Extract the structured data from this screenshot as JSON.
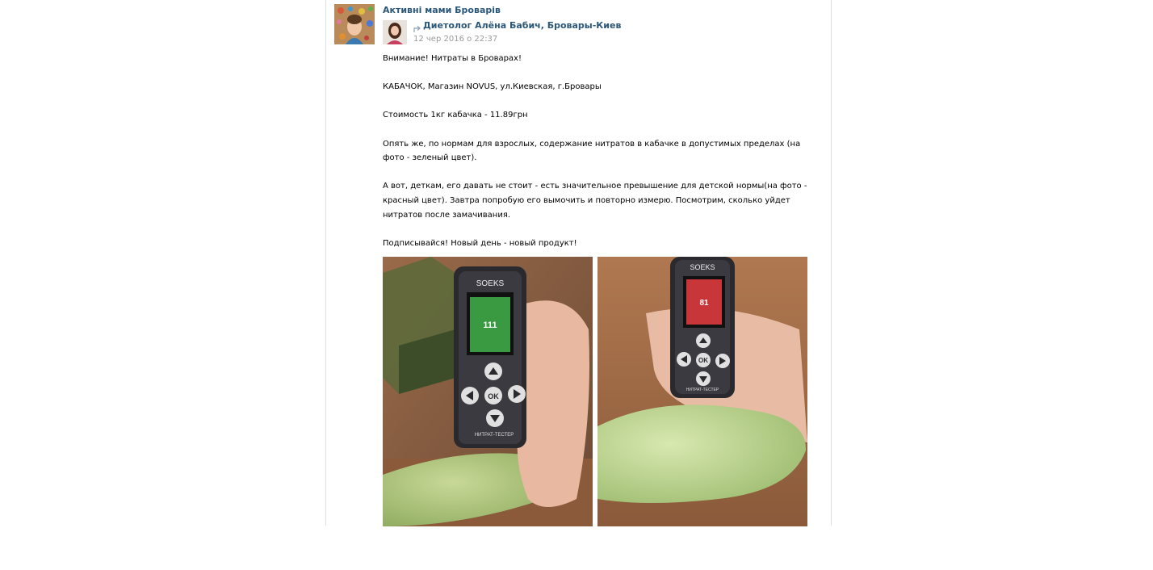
{
  "group": {
    "name": "Активні мами Броварів"
  },
  "author": {
    "name": "Диетолог Алёна Бабич, Бровары-Киев",
    "date": "12 чер 2016 о 22:37"
  },
  "post": {
    "paragraphs": [
      "Внимание! Нитраты в Броварах!",
      "КАБАЧОК, Магазин NOVUS, ул.Киевская, г.Бровары",
      "Стоимость 1кг кабачка - 11.89грн",
      "Опять же, по нормам для взрослых, содержание нитратов в кабачке в допустимых пределах (на фото - зеленый цвет).",
      "А вот, деткам, его давать не стоит - есть значительное превышение для детской нормы(на фото - красный цвет). Завтра попробую его вымочить и повторно измерю. Посмотрим, сколько уйдет нитратов после замачивания.",
      "Подписывайся! Новый день - новый продукт!"
    ]
  },
  "photos": [
    {
      "brand": "SOEKS",
      "device_label": "НИТРАТ-ТЕСТЕР",
      "ok_label": "OK",
      "screen_value": "111",
      "screen_color": "#3a9a42"
    },
    {
      "brand": "SOEKS",
      "device_label": "НИТРАТ-ТЕСТЕР",
      "ok_label": "OK",
      "screen_value": "81",
      "screen_color": "#c8363a"
    }
  ],
  "colors": {
    "link": "#2b587a",
    "date": "#999999",
    "border": "#d8dfe6"
  }
}
